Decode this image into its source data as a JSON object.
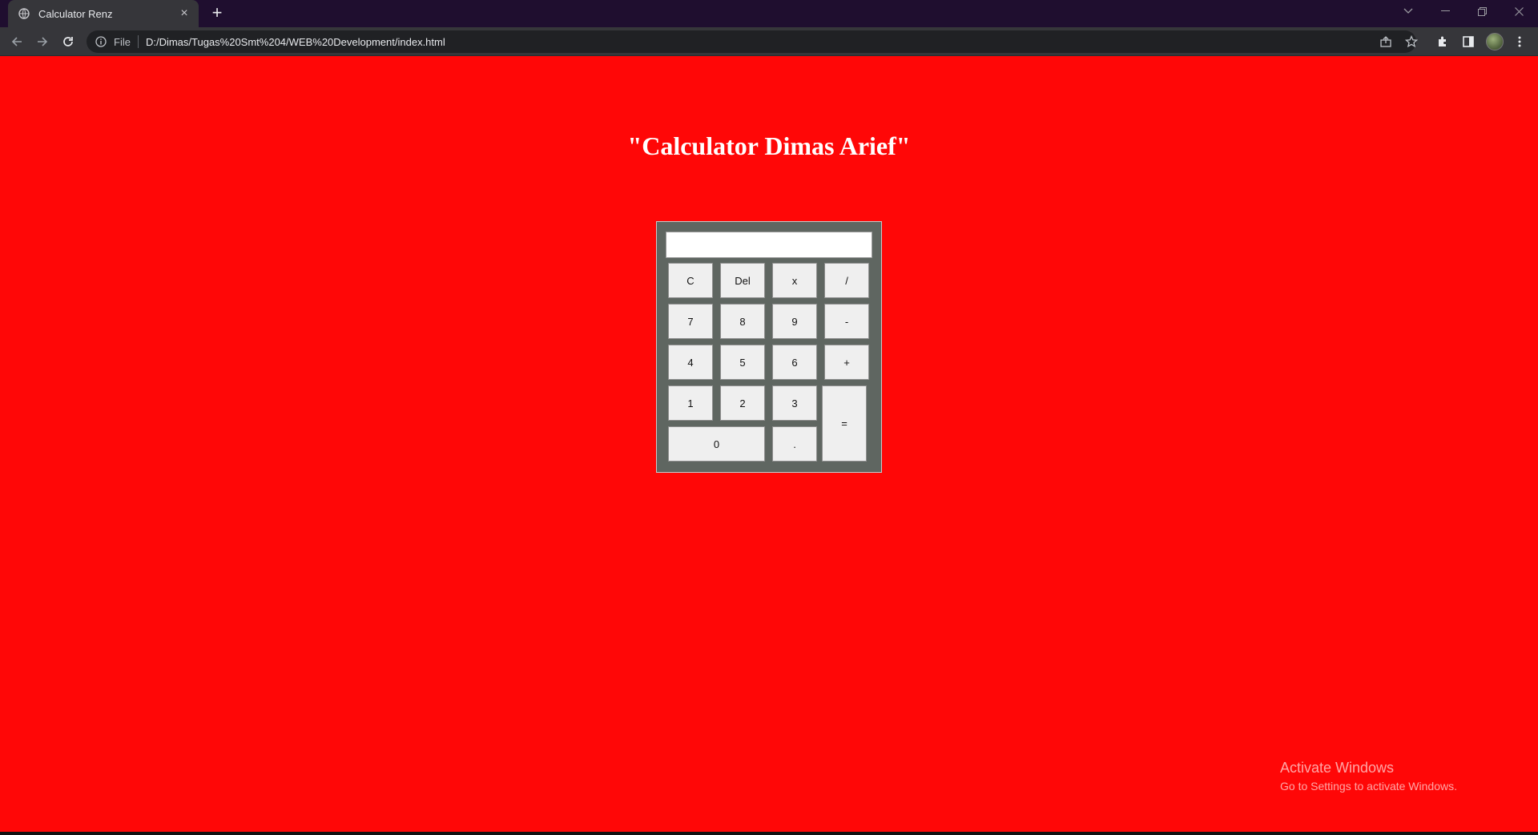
{
  "browser": {
    "tab_title": "Calculator Renz",
    "tab_close": "×",
    "new_tab": "+",
    "address_scheme_label": "File",
    "url": "D:/Dimas/Tugas%20Smt%204/WEB%20Development/index.html"
  },
  "page": {
    "heading": "\"Calculator Dimas Arief\""
  },
  "calculator": {
    "display_value": "",
    "keys": {
      "clear": "C",
      "delete": "Del",
      "multiply": "x",
      "divide": "/",
      "seven": "7",
      "eight": "8",
      "nine": "9",
      "minus": "-",
      "four": "4",
      "five": "5",
      "six": "6",
      "plus": "+",
      "one": "1",
      "two": "2",
      "three": "3",
      "equals": "=",
      "zero": "0",
      "dot": "."
    }
  },
  "os": {
    "activate_title": "Activate Windows",
    "activate_subtitle": "Go to Settings to activate Windows."
  },
  "colors": {
    "page_background": "#ff0707",
    "calculator_body": "#5f6661",
    "key_background": "#efefef"
  }
}
